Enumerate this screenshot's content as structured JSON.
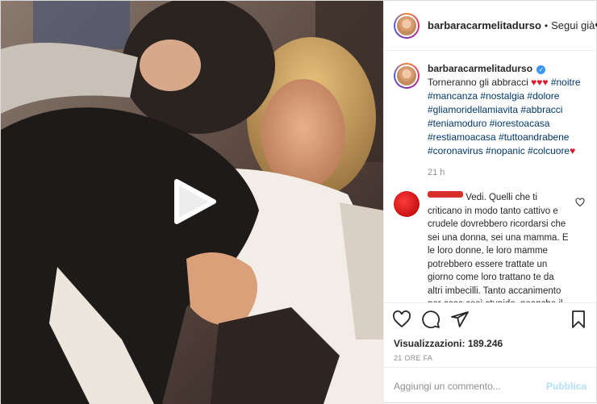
{
  "header": {
    "username": "barbaracarmelitadurso",
    "separator": "•",
    "follow_label": "Segui già",
    "more_icon": "•••"
  },
  "caption": {
    "username": "barbaracarmelitadurso",
    "verified_icon": "✓",
    "text_start": "Torneranno gli abbracci",
    "hearts": "♥♥♥",
    "hashtags_1": "#noitre #mancanza #nostalgia #dolore #gliamoridellamiavita #abbracci #teniamoduro #iorestoacasa #restiamoacasa #tuttoandrabene #coronavirus #nopanic #colcuore",
    "end_heart": "♥",
    "time": "21 h"
  },
  "comment": {
    "text": "Vedi. Quelli che ti criticano in modo tanto cattivo e crudele dovrebbero ricordarsi che sei una donna, sei una mamma. E le loro donne, le loro mamme potrebbero essere trattate un giorno come loro trattano te da altri imbecilli. Tanto accanimento per cose così stupide, neanche il coronavirus vi ha reso migliori."
  },
  "stats": {
    "views_label": "Visualizzazioni:",
    "views_value": "189.246",
    "timestamp": "21 ORE FA"
  },
  "add_comment": {
    "placeholder": "Aggiungi un commento...",
    "publish_label": "Pubblica"
  },
  "icons": {
    "like": "heart-icon",
    "comment": "comment-icon",
    "share": "share-icon",
    "save": "bookmark-icon",
    "play": "play-icon"
  }
}
